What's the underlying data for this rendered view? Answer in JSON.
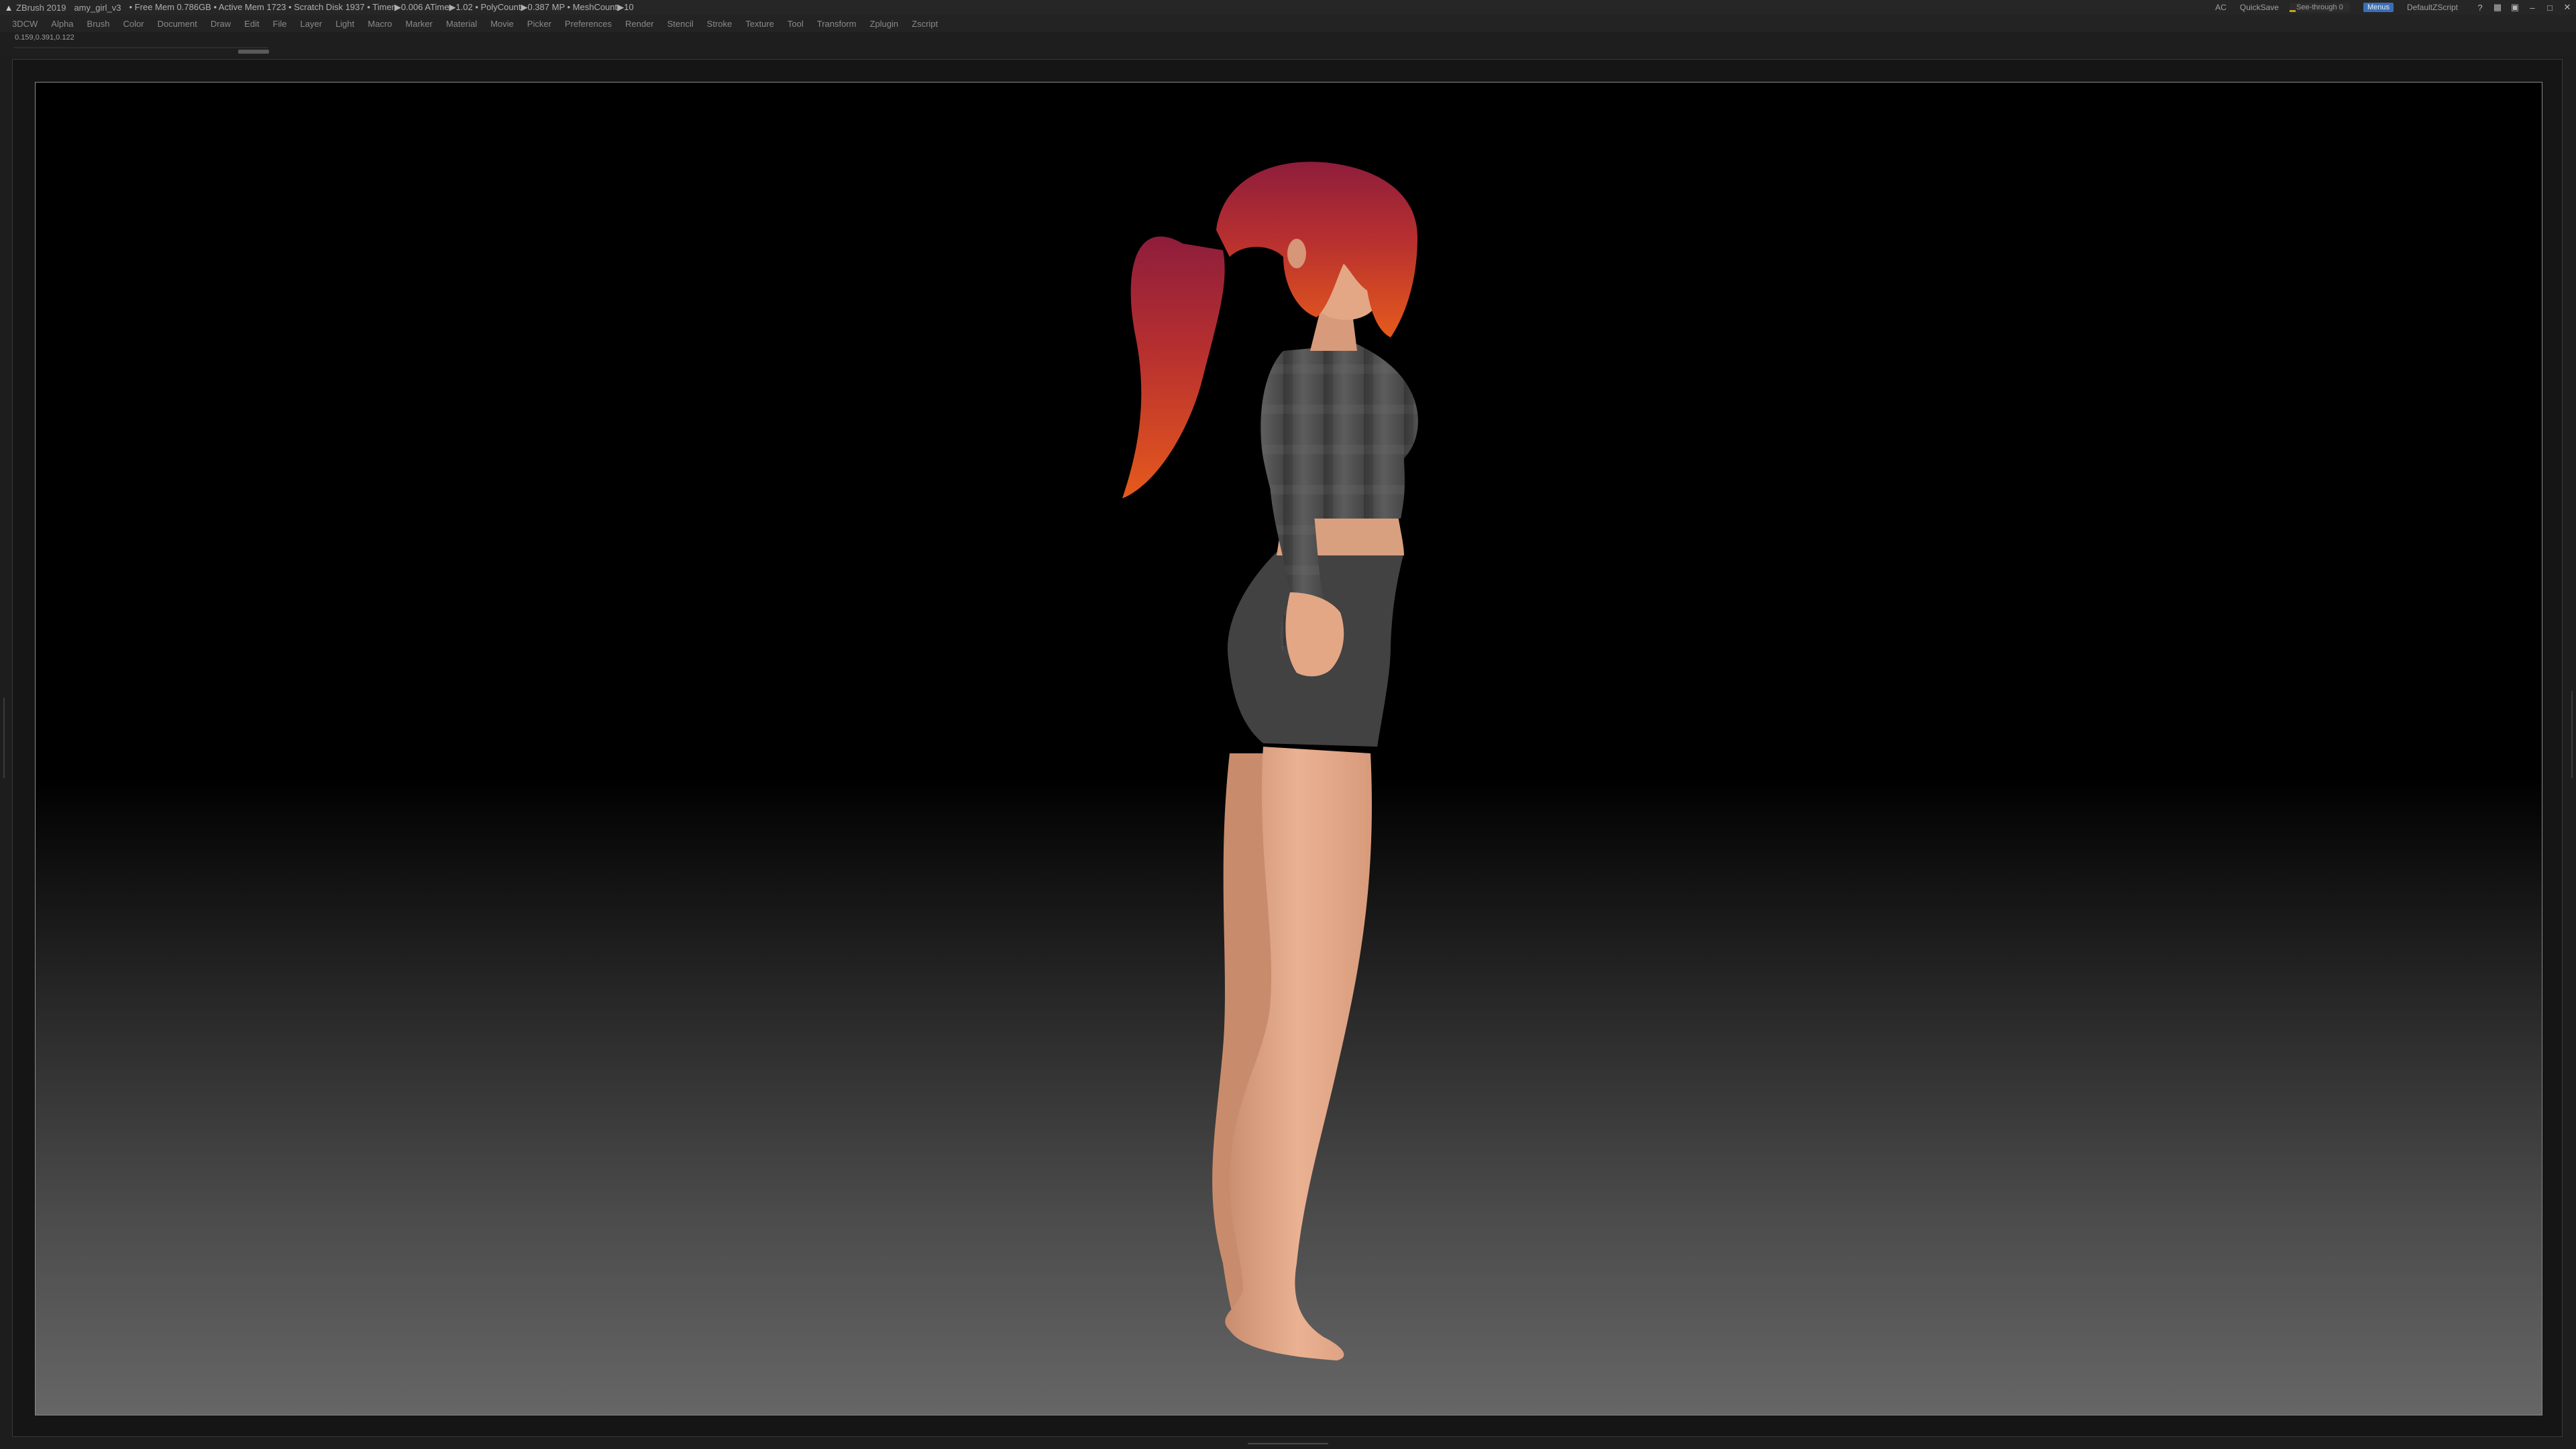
{
  "titlebar": {
    "app": "ZBrush 2019",
    "file": "amy_girl_v3",
    "stats": "• Free Mem 0.786GB • Active Mem 1723 • Scratch Disk 1937 • Timer▶0.006 ATime▶1.02 • PolyCount▶0.387 MP • MeshCount▶10",
    "ac": "AC",
    "quicksave": "QuickSave",
    "seethrough": "See-through  0",
    "seethrough_value": 0,
    "menus": "Menus",
    "script": "DefaultZScript"
  },
  "menubar": {
    "items": [
      "3DCW",
      "Alpha",
      "Brush",
      "Color",
      "Document",
      "Draw",
      "Edit",
      "File",
      "Layer",
      "Light",
      "Macro",
      "Marker",
      "Material",
      "Movie",
      "Picker",
      "Preferences",
      "Render",
      "Stencil",
      "Stroke",
      "Texture",
      "Tool",
      "Transform",
      "Zplugin",
      "Zscript"
    ]
  },
  "infobar": {
    "coord": "0.159,0.391,0.122"
  },
  "colors": {
    "hair_top": "#a9243a",
    "hair_bottom": "#e0591f",
    "skin": "#e0a17f",
    "shirt": "#4c4c4c",
    "shorts": "#3d3d3d",
    "accent": "#3a6fb6"
  },
  "icons": {
    "logo": "zbrush-logo-icon",
    "window": [
      "help-icon",
      "layout-icon",
      "lock-icon",
      "minimize-icon",
      "maximize-icon",
      "close-icon"
    ]
  }
}
